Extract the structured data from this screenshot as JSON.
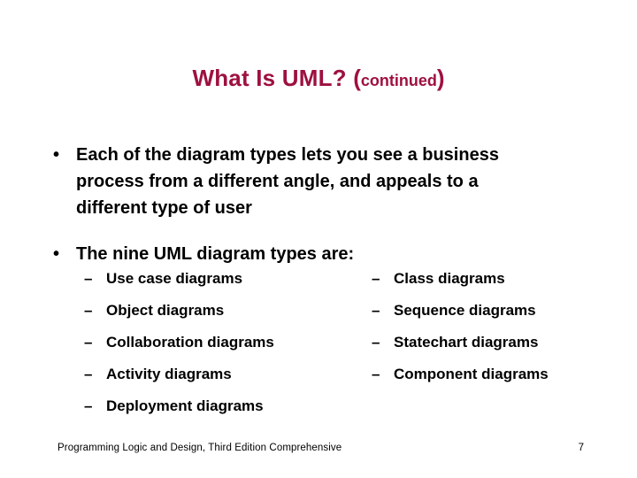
{
  "slide": {
    "title": {
      "main": "What Is UML?",
      "paren_open": "(",
      "sub": "continued",
      "paren_close": ")"
    },
    "bullets": [
      {
        "marker": "•",
        "text": "Each of the diagram types lets you see a business process from a different angle, and appeals to a different type of user"
      },
      {
        "marker": "•",
        "text": "The nine UML diagram types are:"
      }
    ],
    "diagram_types": {
      "dash": "–",
      "left_column": [
        "Use case diagrams",
        "Object diagrams",
        "Collaboration diagrams",
        "Activity diagrams",
        "Deployment diagrams"
      ],
      "right_column": [
        "Class diagrams",
        "Sequence diagrams",
        "Statechart diagrams",
        "Component diagrams"
      ]
    },
    "footer": {
      "text": "Programming Logic and Design, Third Edition Comprehensive",
      "page_number": "7"
    },
    "colors": {
      "title": "#9E1040",
      "body": "#000000",
      "background": "#ffffff"
    }
  }
}
